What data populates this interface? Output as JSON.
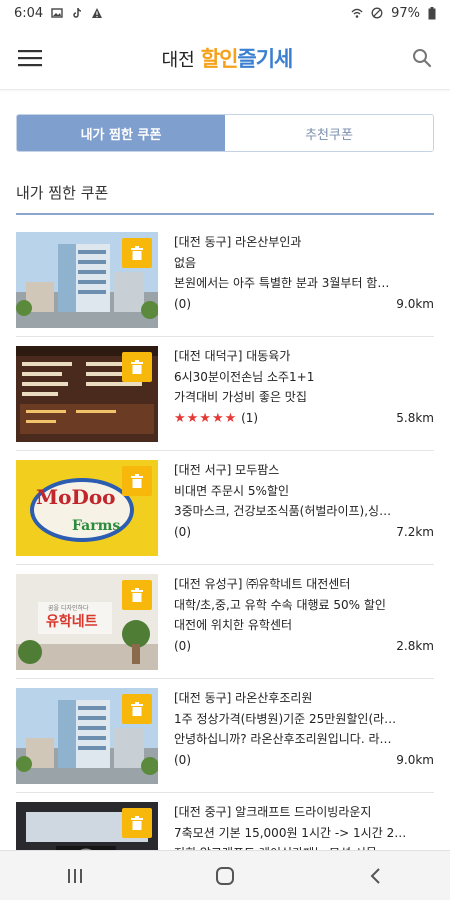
{
  "status": {
    "time": "6:04",
    "battery": "97%"
  },
  "header": {
    "city": "대전",
    "brand_part1": "할인",
    "brand_part2": "즐기세"
  },
  "tabs": [
    {
      "label": "내가 찜한 쿠폰"
    },
    {
      "label": "추천쿠폰"
    }
  ],
  "section_title": "내가 찜한 쿠폰",
  "items": [
    {
      "region": "[대전 동구]",
      "name": "라온산부인과",
      "line2": "없음",
      "line3": "본원에서는 아주 특별한 분과 3월부터 함…",
      "reviews": "(0)",
      "distance": "9.0km"
    },
    {
      "region": "[대전 대덕구]",
      "name": "대동육가",
      "line2": "6시30분이전손님 소주1+1",
      "line3": "가격대비 가성비 좋은 맛집",
      "stars": "★★★★★",
      "reviews": "(1)",
      "distance": "5.8km"
    },
    {
      "region": "[대전 서구]",
      "name": "모두팜스",
      "line2": "비대면 주문시 5%할인",
      "line3": "3중마스크, 건강보조식품(허벌라이프),싱…",
      "reviews": "(0)",
      "distance": "7.2km",
      "logo_text1": "MoDoo",
      "logo_text2": "Farms"
    },
    {
      "region": "[대전 유성구]",
      "name": "㈜유학네트 대전센터",
      "line2": "대학/초,중,고 유학 수속 대행료 50% 할인",
      "line3": "대전에 위치한 유학센터",
      "reviews": "(0)",
      "distance": "2.8km",
      "sign_small": "꿈을 디자인하다",
      "sign_text": "유학네트"
    },
    {
      "region": "[대전 동구]",
      "name": "라온산후조리원",
      "line2": "1주 정상가격(타병원)기준 25만원할인(라…",
      "line3": "안녕하십니까? 라온산후조리원입니다. 라…",
      "reviews": "(0)",
      "distance": "9.0km"
    },
    {
      "region": "[대전 중구]",
      "name": "알크래프트 드라이빙라운지",
      "line2": "7축모션 기본 15,000원 1시간 -> 1시간 2…",
      "line3": "저희 알크래프트 레이싱카페는 모션 시뮬…",
      "reviews": "",
      "distance": ""
    }
  ]
}
